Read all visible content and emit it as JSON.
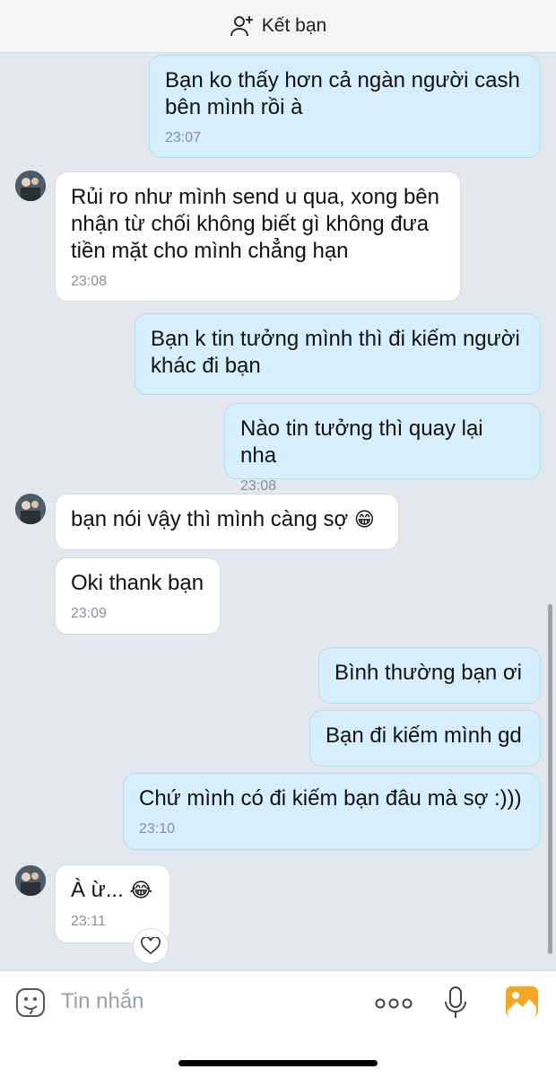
{
  "header": {
    "add_friend_label": "Kết bạn"
  },
  "messages": [
    {
      "text": "Bạn ko thấy hơn cả ngàn người cash bên mình rồi à",
      "time": "23:07"
    },
    {
      "text": "Rủi ro như mình send u qua, xong bên nhận từ chối không biết gì không đưa tiền mặt cho mình chẳng hạn",
      "time": "23:08"
    },
    {
      "text": "Bạn k tin tưởng mình thì đi kiếm người khác đi bạn"
    },
    {
      "text": "Nào tin tưởng thì quay lại nha",
      "time": "23:08"
    },
    {
      "text": "bạn nói vậy thì mình càng sợ",
      "emoji": "😁"
    },
    {
      "text": "Oki thank bạn",
      "time": "23:09"
    },
    {
      "text": "Bình thường bạn ơi"
    },
    {
      "text": "Bạn đi kiếm mình gd"
    },
    {
      "text": "Chứ mình có đi kiếm bạn đâu mà sợ :)))",
      "time": "23:10"
    },
    {
      "text": "À ừ...",
      "emoji": "😂",
      "time": "23:11"
    }
  ],
  "input": {
    "placeholder": "Tin nhắn"
  },
  "icons": {
    "add_friend": "add-user-icon",
    "sticker": "sticker-icon",
    "more": "more-icon",
    "mic": "microphone-icon",
    "gallery": "image-icon",
    "reaction": "heart-icon"
  },
  "colors": {
    "outgoing_bubble": "#d5effc",
    "incoming_bubble": "#ffffff",
    "background": "#e3e7ee",
    "gallery_accent": "#f5a623"
  }
}
